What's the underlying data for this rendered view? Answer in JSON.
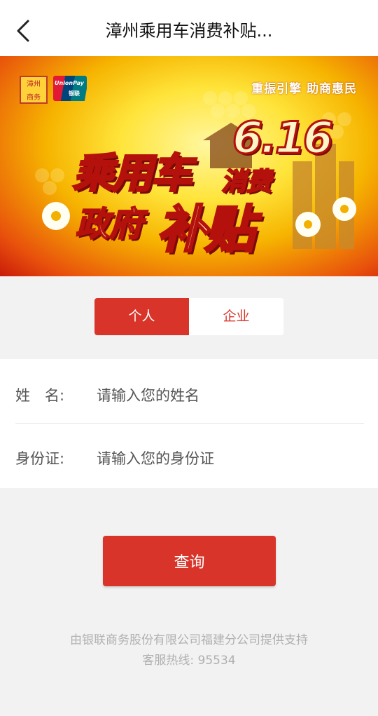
{
  "nav": {
    "title": "漳州乘用车消费补贴...",
    "back_icon": "chevron-left-icon"
  },
  "banner": {
    "local_logo_text": "漳州商务",
    "unionpay_logo_text": "UnionPay",
    "unionpay_logo_cn": "银联",
    "slogan": "重振引擎 助商惠民",
    "date": "6.16",
    "headline_1": "乘用车",
    "headline_1b": "消费",
    "headline_2": "政府",
    "headline_2b": "补贴"
  },
  "tabs": [
    {
      "label": "个人",
      "active": true
    },
    {
      "label": "企业",
      "active": false
    }
  ],
  "form": {
    "name_label": "姓　名:",
    "name_placeholder": "请输入您的姓名",
    "id_label": "身份证:",
    "id_placeholder": "请输入您的身份证"
  },
  "query_button": "查询",
  "footer": {
    "provider": "由银联商务股份有限公司福建分公司提供支持",
    "hotline": "客服热线:  95534"
  },
  "colors": {
    "primary": "#d8342a",
    "background": "#f2f2f2"
  }
}
